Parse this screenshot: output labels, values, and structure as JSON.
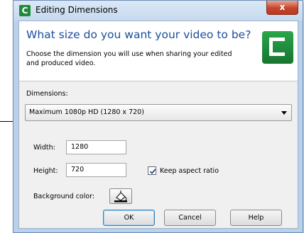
{
  "window": {
    "title": "Editing Dimensions",
    "close_label": "x"
  },
  "header": {
    "heading": "What size do you want your video to be?",
    "subtext": "Choose the dimension you will use when sharing your edited and produced video."
  },
  "dimensions": {
    "label": "Dimensions:",
    "selected": "Maximum 1080p HD (1280 x 720)"
  },
  "width": {
    "label": "Width:",
    "value": "1280"
  },
  "height": {
    "label": "Height:",
    "value": "720"
  },
  "aspect": {
    "label": "Keep aspect ratio",
    "checked": true
  },
  "background": {
    "label": "Background color:"
  },
  "buttons": {
    "ok": "OK",
    "cancel": "Cancel",
    "help": "Help"
  },
  "icons": {
    "app": "camtasia-logo-icon",
    "bg": "paint-bucket-icon",
    "checkbox": "checkmark-icon"
  }
}
